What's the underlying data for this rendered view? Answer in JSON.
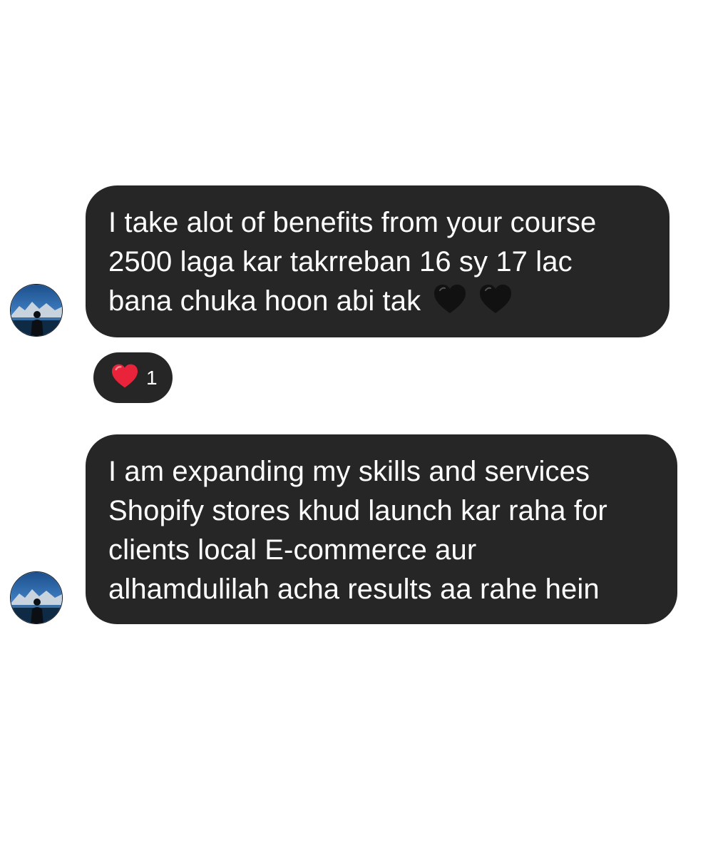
{
  "messages": [
    {
      "lines": [
        "I take alot of benefits from your course",
        "2500 laga kar takrreban 16 sy 17 lac",
        "bana chuka hoon abi tak"
      ],
      "trailing_icons": [
        "black-heart-icon",
        "black-heart-icon"
      ],
      "reaction": {
        "icon": "red-heart-icon",
        "count": "1"
      }
    },
    {
      "lines": [
        "I am expanding my skills and services",
        "Shopify stores khud launch kar raha for",
        "clients local E-commerce aur",
        "alhamdulilah acha results aa rahe hein"
      ]
    }
  ],
  "colors": {
    "bubble": "#262626",
    "text": "#ffffff",
    "background": "#ffffff",
    "reaction_heart": "#e8233a",
    "black_heart": "#111111"
  }
}
